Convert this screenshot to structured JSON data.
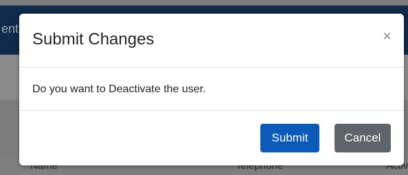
{
  "background": {
    "header_fragment": "ent",
    "columns": [
      "Name",
      "Telephone",
      "Activ"
    ]
  },
  "modal": {
    "title": "Submit Changes",
    "close_symbol": "×",
    "message": "Do you want to Deactivate the user.",
    "submit_label": "Submit",
    "cancel_label": "Cancel"
  },
  "colors": {
    "primary": "#0b5ab7",
    "secondary": "#5f6468",
    "header_bg": "#0f2a4a"
  }
}
